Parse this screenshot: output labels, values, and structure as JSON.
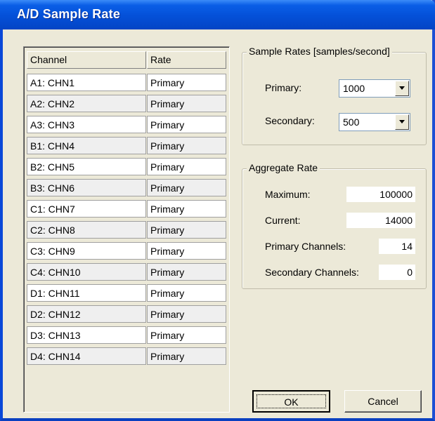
{
  "window": {
    "title": "A/D Sample Rate"
  },
  "table": {
    "headers": {
      "channel": "Channel",
      "rate": "Rate"
    },
    "rows": [
      {
        "channel": "A1: CHN1",
        "rate": "Primary"
      },
      {
        "channel": "A2: CHN2",
        "rate": "Primary"
      },
      {
        "channel": "A3: CHN3",
        "rate": "Primary"
      },
      {
        "channel": "B1: CHN4",
        "rate": "Primary"
      },
      {
        "channel": "B2: CHN5",
        "rate": "Primary"
      },
      {
        "channel": "B3: CHN6",
        "rate": "Primary"
      },
      {
        "channel": "C1: CHN7",
        "rate": "Primary"
      },
      {
        "channel": "C2: CHN8",
        "rate": "Primary"
      },
      {
        "channel": "C3: CHN9",
        "rate": "Primary"
      },
      {
        "channel": "C4: CHN10",
        "rate": "Primary"
      },
      {
        "channel": "D1: CHN11",
        "rate": "Primary"
      },
      {
        "channel": "D2: CHN12",
        "rate": "Primary"
      },
      {
        "channel": "D3: CHN13",
        "rate": "Primary"
      },
      {
        "channel": "D4: CHN14",
        "rate": "Primary"
      }
    ]
  },
  "sample_rates": {
    "label": "Sample Rates [samples/second]",
    "primary_label": "Primary:",
    "primary_value": "1000",
    "secondary_label": "Secondary:",
    "secondary_value": "500"
  },
  "aggregate": {
    "label": "Aggregate Rate",
    "maximum_label": "Maximum:",
    "maximum_value": "100000",
    "current_label": "Current:",
    "current_value": "14000",
    "primary_channels_label": "Primary Channels:",
    "primary_channels_value": "14",
    "secondary_channels_label": "Secondary Channels:",
    "secondary_channels_value": "0"
  },
  "buttons": {
    "ok": "OK",
    "cancel": "Cancel"
  },
  "icons": {
    "dropdown": "chevron-down-icon"
  },
  "colors": {
    "titlebar": "#0450d8",
    "dialog": "#ece9d8"
  }
}
